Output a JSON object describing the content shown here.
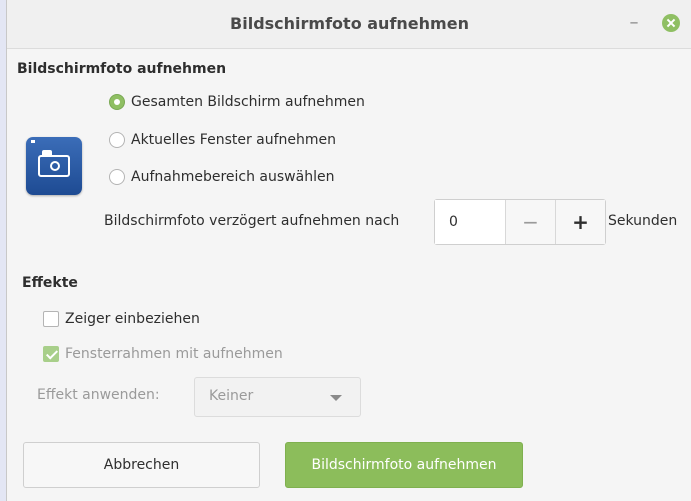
{
  "window": {
    "title": "Bildschirmfoto aufnehmen",
    "minimize_symbol": "–",
    "close_icon": "close-icon"
  },
  "capture": {
    "heading": "Bildschirmfoto aufnehmen",
    "options": [
      {
        "label": "Gesamten Bildschirm aufnehmen",
        "selected": true
      },
      {
        "label": "Aktuelles Fenster aufnehmen",
        "selected": false
      },
      {
        "label": "Aufnahmebereich auswählen",
        "selected": false
      }
    ],
    "delay_label": "Bildschirmfoto verzögert aufnehmen nach",
    "delay_value": "0",
    "minus_symbol": "−",
    "plus_symbol": "+",
    "delay_unit": "Sekunden"
  },
  "effects": {
    "heading": "Effekte",
    "include_pointer": {
      "label": "Zeiger einbeziehen",
      "checked": false
    },
    "include_border": {
      "label": "Fensterrahmen mit aufnehmen",
      "checked": true,
      "disabled": true
    },
    "apply_effect_label": "Effekt anwenden:",
    "apply_effect_value": "Keiner"
  },
  "buttons": {
    "cancel": "Abbrechen",
    "ok": "Bildschirmfoto aufnehmen"
  },
  "colors": {
    "accent": "#8cbd5b",
    "icon_blue": "#2a5aa5"
  }
}
